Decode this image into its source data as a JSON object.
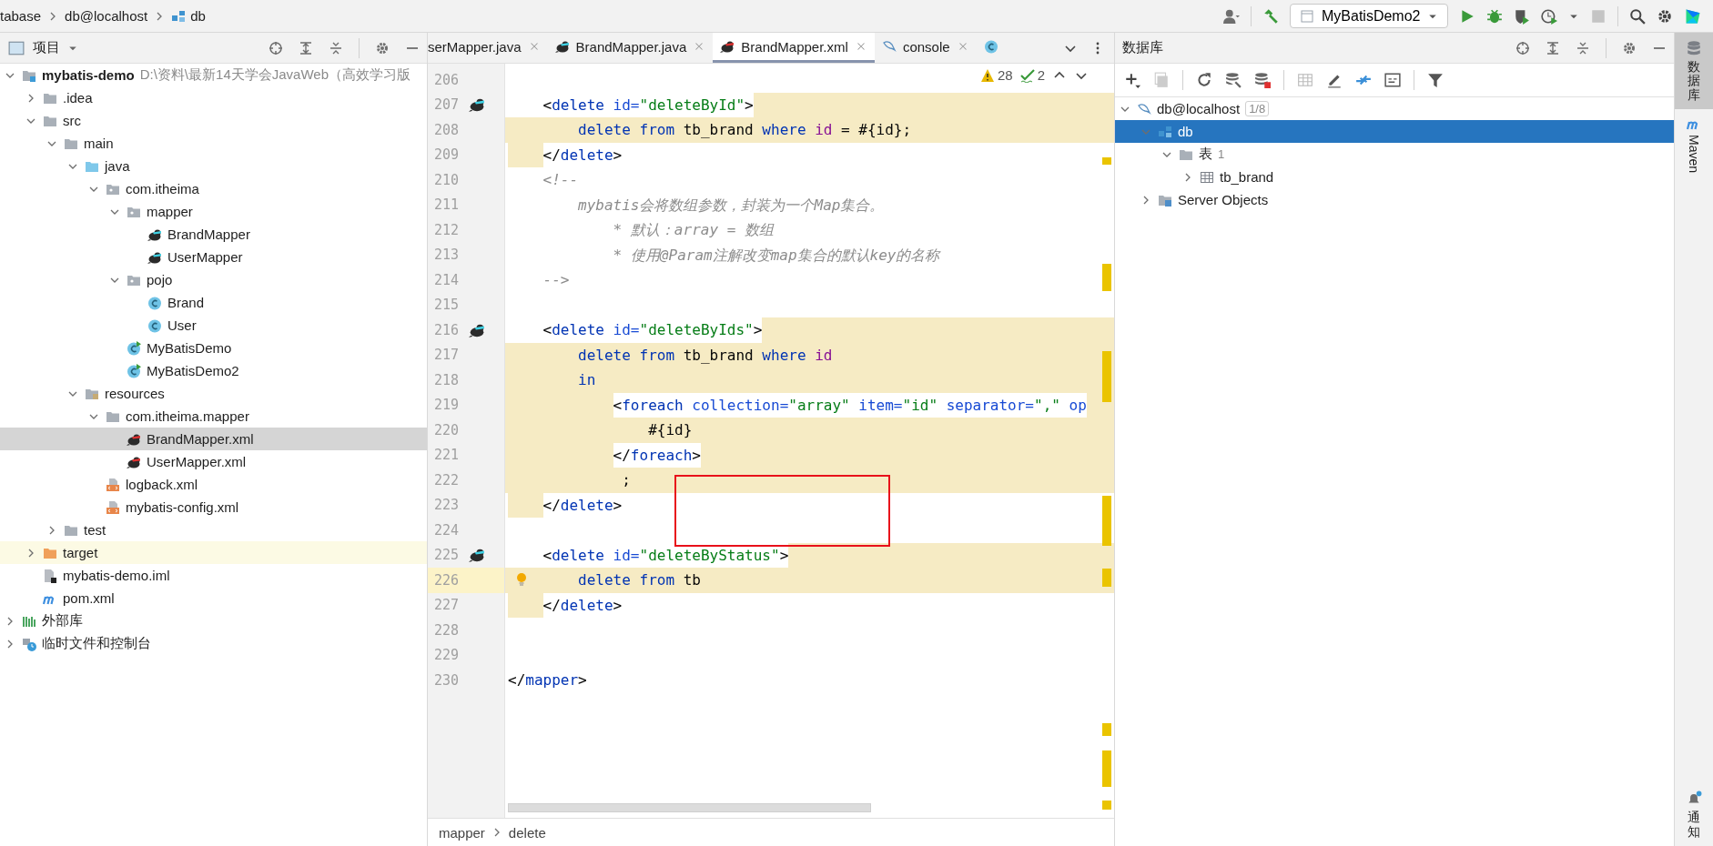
{
  "breadcrumb": [
    {
      "label": "tabase",
      "kind": "text"
    },
    {
      "label": "db@localhost",
      "kind": "text"
    },
    {
      "label": "db",
      "kind": "schema"
    }
  ],
  "run_config": {
    "label": "MyBatisDemo2"
  },
  "project_panel": {
    "title": "项目",
    "tree": [
      {
        "label": "mybatis-demo",
        "hint": "D:\\资料\\最新14天学会JavaWeb（高效学习版",
        "kind": "module",
        "expanded": true,
        "selected": false,
        "children": [
          {
            "label": ".idea",
            "kind": "folder",
            "expanded": false,
            "selected": false
          },
          {
            "label": "src",
            "kind": "folder",
            "expanded": true,
            "selected": false,
            "children": [
              {
                "label": "main",
                "kind": "folder",
                "expanded": true,
                "selected": false,
                "children": [
                  {
                    "label": "java",
                    "kind": "source",
                    "expanded": true,
                    "selected": false,
                    "children": [
                      {
                        "label": "com.itheima",
                        "kind": "package",
                        "expanded": true,
                        "selected": false,
                        "children": [
                          {
                            "label": "mapper",
                            "kind": "package",
                            "expanded": true,
                            "selected": false,
                            "children": [
                              {
                                "label": "BrandMapper",
                                "kind": "mapper",
                                "selected": false
                              },
                              {
                                "label": "UserMapper",
                                "kind": "mapper",
                                "selected": false
                              }
                            ]
                          },
                          {
                            "label": "pojo",
                            "kind": "package",
                            "expanded": true,
                            "selected": false,
                            "children": [
                              {
                                "label": "Brand",
                                "kind": "class",
                                "selected": false
                              },
                              {
                                "label": "User",
                                "kind": "class",
                                "selected": false
                              }
                            ]
                          },
                          {
                            "label": "MyBatisDemo",
                            "kind": "main-class",
                            "selected": false
                          },
                          {
                            "label": "MyBatisDemo2",
                            "kind": "main-class",
                            "selected": false
                          }
                        ]
                      }
                    ]
                  },
                  {
                    "label": "resources",
                    "kind": "resources",
                    "expanded": true,
                    "selected": false,
                    "children": [
                      {
                        "label": "com.itheima.mapper",
                        "kind": "folder",
                        "expanded": true,
                        "selected": false,
                        "children": [
                          {
                            "label": "BrandMapper.xml",
                            "kind": "mapper-xml",
                            "selected": true
                          },
                          {
                            "label": "UserMapper.xml",
                            "kind": "mapper-xml",
                            "selected": false
                          }
                        ]
                      },
                      {
                        "label": "logback.xml",
                        "kind": "xml",
                        "selected": false
                      },
                      {
                        "label": "mybatis-config.xml",
                        "kind": "xml",
                        "selected": false
                      }
                    ]
                  }
                ]
              },
              {
                "label": "test",
                "kind": "folder",
                "expanded": false,
                "selected": false
              }
            ]
          },
          {
            "label": "target",
            "kind": "excluded",
            "expanded": false,
            "selected": false
          },
          {
            "label": "mybatis-demo.iml",
            "kind": "iml",
            "selected": false
          },
          {
            "label": "pom.xml",
            "kind": "maven",
            "selected": false
          }
        ]
      },
      {
        "label": "外部库",
        "kind": "library",
        "expanded": false,
        "selected": false
      },
      {
        "label": "临时文件和控制台",
        "kind": "scratch",
        "expanded": false,
        "selected": false
      }
    ]
  },
  "editor": {
    "tabs": [
      {
        "label": "serMapper.java",
        "kind": "plain",
        "selected": false
      },
      {
        "label": "BrandMapper.java",
        "kind": "mapper",
        "selected": false
      },
      {
        "label": "BrandMapper.xml",
        "kind": "mapper-xml",
        "selected": true
      },
      {
        "label": "console",
        "kind": "console",
        "selected": false
      },
      {
        "kind": "class",
        "selected": false
      }
    ],
    "inspections": {
      "warnings": "28",
      "typos": "2"
    },
    "lines": [
      {
        "number": "206",
        "kind": "none",
        "current": false,
        "mapper_link": false,
        "intention": false
      },
      {
        "number": "207",
        "kind": "open",
        "current": false,
        "mapper_link": true,
        "intention": false,
        "tokens": [
          {
            "kind": "text",
            "text": "    <"
          },
          {
            "kind": "tag",
            "text": "delete"
          },
          {
            "kind": "attr",
            "text": " id="
          },
          {
            "kind": "value",
            "text": "\"deleteById\""
          },
          {
            "kind": "text",
            "text": ">"
          }
        ]
      },
      {
        "number": "208",
        "kind": "body",
        "current": false,
        "mapper_link": false,
        "intention": false,
        "tokens": [
          {
            "kind": "kw",
            "text": "        delete"
          },
          {
            "kind": "kw",
            "text": " from"
          },
          {
            "kind": "text",
            "text": " tb_brand "
          },
          {
            "kind": "kw",
            "text": "where"
          },
          {
            "kind": "ident",
            "text": " id"
          },
          {
            "kind": "text",
            "text": " = #{id};"
          }
        ]
      },
      {
        "number": "209",
        "kind": "close",
        "current": false,
        "mapper_link": false,
        "intention": false,
        "tokens": [
          {
            "kind": "text",
            "text": "    </"
          },
          {
            "kind": "tag",
            "text": "delete"
          },
          {
            "kind": "text",
            "text": ">"
          }
        ]
      },
      {
        "number": "210",
        "kind": "none",
        "current": false,
        "mapper_link": false,
        "intention": false,
        "tokens": [
          {
            "kind": "comment",
            "text": "    <!--"
          }
        ]
      },
      {
        "number": "211",
        "kind": "none",
        "current": false,
        "mapper_link": false,
        "intention": false,
        "tokens": [
          {
            "kind": "comment",
            "text": "        mybatis会将数组参数，封装为一个Map集合。"
          }
        ]
      },
      {
        "number": "212",
        "kind": "none",
        "current": false,
        "mapper_link": false,
        "intention": false,
        "tokens": [
          {
            "kind": "comment",
            "text": "            * 默认：array = 数组"
          }
        ]
      },
      {
        "number": "213",
        "kind": "none",
        "current": false,
        "mapper_link": false,
        "intention": false,
        "tokens": [
          {
            "kind": "comment",
            "text": "            * 使用@Param注解改变map集合的默认key的名称"
          }
        ]
      },
      {
        "number": "214",
        "kind": "none",
        "current": false,
        "mapper_link": false,
        "intention": false,
        "tokens": [
          {
            "kind": "comment",
            "text": "    -->"
          }
        ]
      },
      {
        "number": "215",
        "kind": "none",
        "current": false,
        "mapper_link": false,
        "intention": false
      },
      {
        "number": "216",
        "kind": "open",
        "current": false,
        "mapper_link": true,
        "intention": false,
        "tokens": [
          {
            "kind": "text",
            "text": "    <"
          },
          {
            "kind": "tag",
            "text": "delete"
          },
          {
            "kind": "attr",
            "text": " id="
          },
          {
            "kind": "value",
            "text": "\"deleteByIds\""
          },
          {
            "kind": "text",
            "text": ">"
          }
        ]
      },
      {
        "number": "217",
        "kind": "body",
        "current": false,
        "mapper_link": false,
        "intention": false,
        "tokens": [
          {
            "kind": "kw",
            "text": "        delete"
          },
          {
            "kind": "kw",
            "text": " from"
          },
          {
            "kind": "text",
            "text": " tb_brand "
          },
          {
            "kind": "kw",
            "text": "where"
          },
          {
            "kind": "ident",
            "text": " id"
          }
        ]
      },
      {
        "number": "218",
        "kind": "body",
        "current": false,
        "mapper_link": false,
        "intention": false,
        "tokens": [
          {
            "kind": "kw",
            "text": "        in"
          }
        ]
      },
      {
        "number": "219",
        "kind": "body-tag",
        "current": false,
        "mapper_link": false,
        "intention": false,
        "tokens": [
          {
            "kind": "text",
            "text": "            <"
          },
          {
            "kind": "tag",
            "text": "foreach"
          },
          {
            "kind": "attr",
            "text": " collection="
          },
          {
            "kind": "value",
            "text": "\"array\""
          },
          {
            "kind": "attr",
            "text": " item="
          },
          {
            "kind": "value",
            "text": "\"id\""
          },
          {
            "kind": "attr",
            "text": " separator="
          },
          {
            "kind": "value",
            "text": "\",\""
          },
          {
            "kind": "attr",
            "text": " op"
          }
        ]
      },
      {
        "number": "220",
        "kind": "body",
        "current": false,
        "mapper_link": false,
        "intention": false,
        "tokens": [
          {
            "kind": "text",
            "text": "                #{id}"
          }
        ]
      },
      {
        "number": "221",
        "kind": "body-tag",
        "current": false,
        "mapper_link": false,
        "intention": false,
        "tokens": [
          {
            "kind": "text",
            "text": "            </"
          },
          {
            "kind": "tag",
            "text": "foreach"
          },
          {
            "kind": "text",
            "text": ">"
          }
        ]
      },
      {
        "number": "222",
        "kind": "body",
        "current": false,
        "mapper_link": false,
        "intention": false,
        "tokens": [
          {
            "kind": "text",
            "text": "             ;"
          }
        ]
      },
      {
        "number": "223",
        "kind": "close",
        "current": false,
        "mapper_link": false,
        "intention": false,
        "tokens": [
          {
            "kind": "text",
            "text": "    </"
          },
          {
            "kind": "tag",
            "text": "delete"
          },
          {
            "kind": "text",
            "text": ">"
          }
        ]
      },
      {
        "number": "224",
        "kind": "none",
        "current": false,
        "mapper_link": false,
        "intention": false
      },
      {
        "number": "225",
        "kind": "open",
        "current": false,
        "mapper_link": true,
        "intention": false,
        "tokens": [
          {
            "kind": "text",
            "text": "    <"
          },
          {
            "kind": "tag",
            "text": "delete"
          },
          {
            "kind": "attr",
            "text": " id="
          },
          {
            "kind": "value",
            "text": "\"deleteByStatus\""
          },
          {
            "kind": "text",
            "text": ">"
          }
        ]
      },
      {
        "number": "226",
        "kind": "body",
        "current": true,
        "mapper_link": false,
        "intention": true,
        "tokens": [
          {
            "kind": "kw",
            "text": "        delete"
          },
          {
            "kind": "kw",
            "text": " from"
          },
          {
            "kind": "text",
            "text": " tb"
          }
        ]
      },
      {
        "number": "227",
        "kind": "close",
        "current": false,
        "mapper_link": false,
        "intention": false,
        "tokens": [
          {
            "kind": "text",
            "text": "    </"
          },
          {
            "kind": "tag",
            "text": "delete"
          },
          {
            "kind": "text",
            "text": ">"
          }
        ]
      },
      {
        "number": "228",
        "kind": "none",
        "current": false,
        "mapper_link": false,
        "intention": false
      },
      {
        "number": "229",
        "kind": "none",
        "current": false,
        "mapper_link": false,
        "intention": false
      },
      {
        "number": "230",
        "kind": "none",
        "current": false,
        "mapper_link": false,
        "intention": false,
        "tokens": [
          {
            "kind": "text",
            "text": "</"
          },
          {
            "kind": "tag",
            "text": "mapper"
          },
          {
            "kind": "text",
            "text": ">"
          }
        ]
      }
    ],
    "path": [
      "mapper",
      "delete"
    ]
  },
  "database_panel": {
    "title": "数据库",
    "tree": [
      {
        "label": "db@localhost",
        "badge": "1/8",
        "kind": "connection",
        "expanded": true,
        "selected": false,
        "children": [
          {
            "label": "db",
            "kind": "schema",
            "expanded": true,
            "selected": true,
            "children": [
              {
                "label": "表",
                "count": "1",
                "kind": "folder",
                "expanded": true,
                "selected": false,
                "children": [
                  {
                    "label": "tb_brand",
                    "kind": "table",
                    "expanded": false,
                    "selected": false
                  }
                ]
              }
            ]
          },
          {
            "label": "Server Objects",
            "kind": "server",
            "expanded": false,
            "selected": false
          }
        ]
      }
    ]
  },
  "tool_strip": [
    {
      "label": "数据库",
      "kind": "database",
      "selected": true
    },
    {
      "label": "Maven",
      "kind": "maven",
      "selected": false
    },
    {
      "label": "通知",
      "kind": "notifications",
      "selected": false
    }
  ]
}
